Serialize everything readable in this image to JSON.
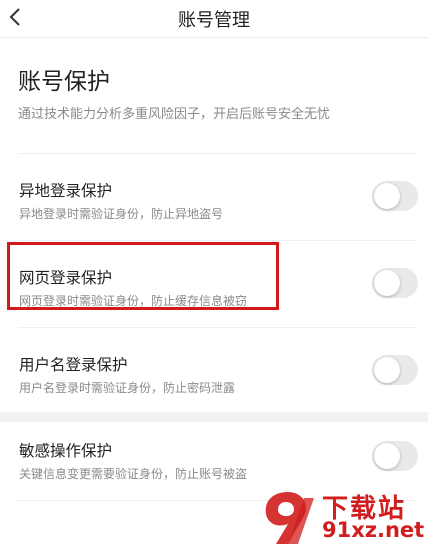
{
  "header": {
    "title": "账号管理"
  },
  "section": {
    "title": "账号保护",
    "description": "通过技术能力分析多重风险因子，开启后账号安全无忧"
  },
  "items": [
    {
      "title": "异地登录保护",
      "subtitle": "异地登录时需验证身份，防止异地盗号",
      "enabled": false
    },
    {
      "title": "网页登录保护",
      "subtitle": "网页登录时需验证身份，防止缓存信息被窃",
      "enabled": false
    },
    {
      "title": "用户名登录保护",
      "subtitle": "用户名登录时需验证身份，防止密码泄露",
      "enabled": false
    },
    {
      "title": "敏感操作保护",
      "subtitle": "关键信息变更需要验证身份，防止账号被盗",
      "enabled": false
    }
  ],
  "watermark": {
    "top_text": "下载站",
    "bottom_text": "91xz.net"
  },
  "colors": {
    "highlight": "#d21a1a",
    "toggle_off": "#e9e9e9",
    "subtitle": "#8a8a8a"
  }
}
